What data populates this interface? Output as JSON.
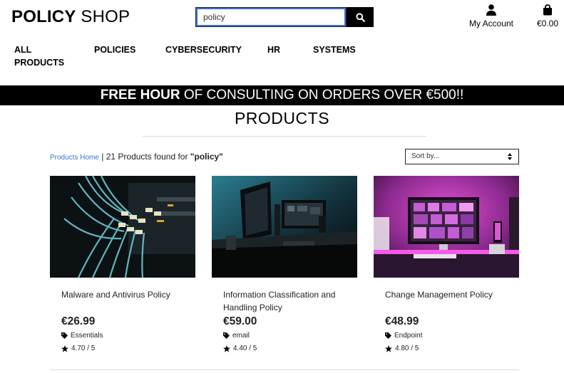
{
  "header": {
    "logo_bold": "POLICY",
    "logo_light": " SHOP",
    "search_value": "policy",
    "account_label": "My Account",
    "bag_total": "€0.00"
  },
  "nav": {
    "items": [
      {
        "line1": "ALL",
        "line2": "PRODUCTS"
      },
      {
        "line1": "POLICIES"
      },
      {
        "line1": "CYBERSECURITY"
      },
      {
        "line1": "HR"
      },
      {
        "line1": "SYSTEMS"
      }
    ]
  },
  "promo": {
    "bold": "FREE HOUR",
    "rest": " OF CONSULTING ON ORDERS OVER €500!!"
  },
  "page": {
    "heading": "PRODUCTS",
    "breadcrumb_link": "Products Home",
    "separator": " | ",
    "results_text": "21 Products found for ",
    "query": "\"policy\"",
    "sort_label": "Sort by..."
  },
  "products": [
    {
      "name": "Malware and Antivirus Policy",
      "price": "€26.99",
      "category": "Essentials",
      "rating": "4.70 / 5"
    },
    {
      "name": "Information Classification and Handling Policy",
      "price": "€59.00",
      "category": "email",
      "rating": "4.40 / 5"
    },
    {
      "name": "Change Management Policy",
      "price": "€48.99",
      "category": "Endpoint",
      "rating": "4.80 / 5"
    }
  ],
  "icons": {
    "search": "search-icon",
    "account": "user-icon",
    "bag": "shopping-bag-icon",
    "tag": "tag-icon",
    "star": "star-icon",
    "sort": "sort-arrows-icon"
  }
}
